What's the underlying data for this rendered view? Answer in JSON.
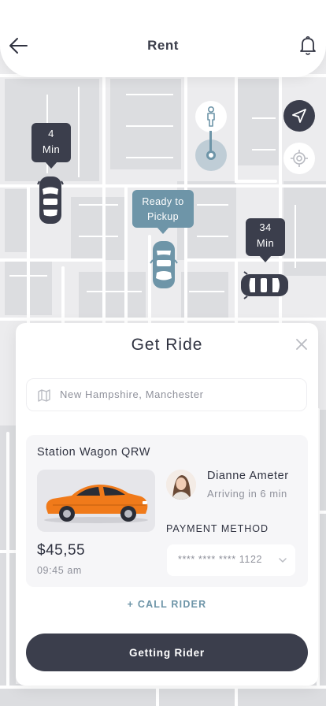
{
  "header": {
    "title": "Rent",
    "back_icon": "arrow-left-icon",
    "notification_icon": "bell-icon"
  },
  "map": {
    "markers": [
      {
        "line1": "4",
        "line2": "Min"
      },
      {
        "line1": "Ready to",
        "line2": "Pickup"
      },
      {
        "line1": "34",
        "line2": "Min"
      }
    ],
    "controls": {
      "navigate_icon": "navigation-arrow-icon",
      "locate_icon": "crosshair-icon"
    }
  },
  "panel": {
    "title": "Get Ride",
    "address": "New Hampshire, Manchester",
    "vehicle_name": "Station Wagon QRW",
    "price": "$45,55",
    "time": "09:45 am",
    "driver": {
      "name": "Dianne Ameter",
      "status": "Arriving in 6 min"
    },
    "payment": {
      "label": "PAYMENT METHOD",
      "selected": "**** **** **** 1122"
    },
    "call_rider": "+ CALL RIDER",
    "primary_button": "Getting Rider"
  },
  "colors": {
    "dark": "#3b3e4c",
    "accent": "#6e95a8",
    "muted_text": "#8f919b",
    "car_orange": "#f07a1a"
  }
}
